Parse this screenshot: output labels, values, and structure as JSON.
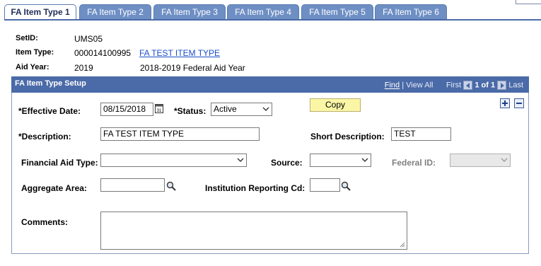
{
  "tabs": [
    {
      "label": "FA Item Type 1",
      "active": true
    },
    {
      "label": "FA Item Type 2",
      "active": false
    },
    {
      "label": "FA Item Type 3",
      "active": false
    },
    {
      "label": "FA Item Type 4",
      "active": false
    },
    {
      "label": "FA Item Type 5",
      "active": false
    },
    {
      "label": "FA Item Type 6",
      "active": false
    }
  ],
  "header": {
    "setid_label": "SetID:",
    "setid_value": "UMS05",
    "item_type_label": "Item Type:",
    "item_type_value": "000014100995",
    "item_type_link": "FA TEST ITEM TYPE",
    "aid_year_label": "Aid Year:",
    "aid_year_value": "2019",
    "aid_year_desc": "2018-2019 Federal Aid Year"
  },
  "grid": {
    "title": "FA Item Type Setup",
    "find": "Find",
    "view_all": "View All",
    "first": "First",
    "range": "1 of 1",
    "last": "Last"
  },
  "form": {
    "effective_date_label": "*Effective Date:",
    "effective_date_value": "08/15/2018",
    "status_label": "*Status:",
    "status_value": "Active",
    "copy_label": "Copy",
    "description_label": "*Description:",
    "description_value": "FA TEST ITEM TYPE",
    "short_desc_label": "Short Description:",
    "short_desc_value": "TEST",
    "fin_aid_type_label": "Financial Aid Type:",
    "fin_aid_type_value": "",
    "source_label": "Source:",
    "source_value": "",
    "federal_id_label": "Federal ID:",
    "federal_id_value": "",
    "aggregate_label": "Aggregate Area:",
    "aggregate_value": "",
    "inst_reporting_label": "Institution Reporting Cd:",
    "inst_reporting_value": "",
    "comments_label": "Comments:",
    "comments_value": ""
  },
  "colors": {
    "tab_inactive": "#6e8fc4",
    "grid_header": "#4a6aa8",
    "copy_button": "#fbf6a6",
    "link": "#1a4fcc"
  },
  "icons": [
    "calendar-icon",
    "lookup-icon",
    "add-row-icon",
    "delete-row-icon",
    "chevron-down-icon",
    "first-arrow-icon",
    "last-arrow-icon"
  ]
}
